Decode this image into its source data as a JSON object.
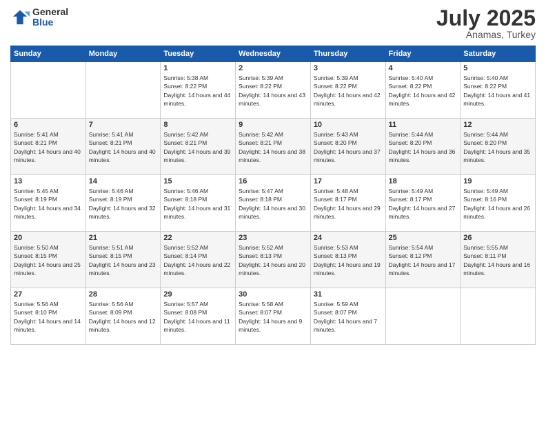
{
  "logo": {
    "general": "General",
    "blue": "Blue"
  },
  "header": {
    "month": "July 2025",
    "location": "Anamas, Turkey"
  },
  "weekdays": [
    "Sunday",
    "Monday",
    "Tuesday",
    "Wednesday",
    "Thursday",
    "Friday",
    "Saturday"
  ],
  "weeks": [
    [
      {
        "day": "",
        "info": ""
      },
      {
        "day": "",
        "info": ""
      },
      {
        "day": "1",
        "info": "Sunrise: 5:38 AM\nSunset: 8:22 PM\nDaylight: 14 hours and 44 minutes."
      },
      {
        "day": "2",
        "info": "Sunrise: 5:39 AM\nSunset: 8:22 PM\nDaylight: 14 hours and 43 minutes."
      },
      {
        "day": "3",
        "info": "Sunrise: 5:39 AM\nSunset: 8:22 PM\nDaylight: 14 hours and 42 minutes."
      },
      {
        "day": "4",
        "info": "Sunrise: 5:40 AM\nSunset: 8:22 PM\nDaylight: 14 hours and 42 minutes."
      },
      {
        "day": "5",
        "info": "Sunrise: 5:40 AM\nSunset: 8:22 PM\nDaylight: 14 hours and 41 minutes."
      }
    ],
    [
      {
        "day": "6",
        "info": "Sunrise: 5:41 AM\nSunset: 8:21 PM\nDaylight: 14 hours and 40 minutes."
      },
      {
        "day": "7",
        "info": "Sunrise: 5:41 AM\nSunset: 8:21 PM\nDaylight: 14 hours and 40 minutes."
      },
      {
        "day": "8",
        "info": "Sunrise: 5:42 AM\nSunset: 8:21 PM\nDaylight: 14 hours and 39 minutes."
      },
      {
        "day": "9",
        "info": "Sunrise: 5:42 AM\nSunset: 8:21 PM\nDaylight: 14 hours and 38 minutes."
      },
      {
        "day": "10",
        "info": "Sunrise: 5:43 AM\nSunset: 8:20 PM\nDaylight: 14 hours and 37 minutes."
      },
      {
        "day": "11",
        "info": "Sunrise: 5:44 AM\nSunset: 8:20 PM\nDaylight: 14 hours and 36 minutes."
      },
      {
        "day": "12",
        "info": "Sunrise: 5:44 AM\nSunset: 8:20 PM\nDaylight: 14 hours and 35 minutes."
      }
    ],
    [
      {
        "day": "13",
        "info": "Sunrise: 5:45 AM\nSunset: 8:19 PM\nDaylight: 14 hours and 34 minutes."
      },
      {
        "day": "14",
        "info": "Sunrise: 5:46 AM\nSunset: 8:19 PM\nDaylight: 14 hours and 32 minutes."
      },
      {
        "day": "15",
        "info": "Sunrise: 5:46 AM\nSunset: 8:18 PM\nDaylight: 14 hours and 31 minutes."
      },
      {
        "day": "16",
        "info": "Sunrise: 5:47 AM\nSunset: 8:18 PM\nDaylight: 14 hours and 30 minutes."
      },
      {
        "day": "17",
        "info": "Sunrise: 5:48 AM\nSunset: 8:17 PM\nDaylight: 14 hours and 29 minutes."
      },
      {
        "day": "18",
        "info": "Sunrise: 5:49 AM\nSunset: 8:17 PM\nDaylight: 14 hours and 27 minutes."
      },
      {
        "day": "19",
        "info": "Sunrise: 5:49 AM\nSunset: 8:16 PM\nDaylight: 14 hours and 26 minutes."
      }
    ],
    [
      {
        "day": "20",
        "info": "Sunrise: 5:50 AM\nSunset: 8:15 PM\nDaylight: 14 hours and 25 minutes."
      },
      {
        "day": "21",
        "info": "Sunrise: 5:51 AM\nSunset: 8:15 PM\nDaylight: 14 hours and 23 minutes."
      },
      {
        "day": "22",
        "info": "Sunrise: 5:52 AM\nSunset: 8:14 PM\nDaylight: 14 hours and 22 minutes."
      },
      {
        "day": "23",
        "info": "Sunrise: 5:52 AM\nSunset: 8:13 PM\nDaylight: 14 hours and 20 minutes."
      },
      {
        "day": "24",
        "info": "Sunrise: 5:53 AM\nSunset: 8:13 PM\nDaylight: 14 hours and 19 minutes."
      },
      {
        "day": "25",
        "info": "Sunrise: 5:54 AM\nSunset: 8:12 PM\nDaylight: 14 hours and 17 minutes."
      },
      {
        "day": "26",
        "info": "Sunrise: 5:55 AM\nSunset: 8:11 PM\nDaylight: 14 hours and 16 minutes."
      }
    ],
    [
      {
        "day": "27",
        "info": "Sunrise: 5:56 AM\nSunset: 8:10 PM\nDaylight: 14 hours and 14 minutes."
      },
      {
        "day": "28",
        "info": "Sunrise: 5:56 AM\nSunset: 8:09 PM\nDaylight: 14 hours and 12 minutes."
      },
      {
        "day": "29",
        "info": "Sunrise: 5:57 AM\nSunset: 8:08 PM\nDaylight: 14 hours and 11 minutes."
      },
      {
        "day": "30",
        "info": "Sunrise: 5:58 AM\nSunset: 8:07 PM\nDaylight: 14 hours and 9 minutes."
      },
      {
        "day": "31",
        "info": "Sunrise: 5:59 AM\nSunset: 8:07 PM\nDaylight: 14 hours and 7 minutes."
      },
      {
        "day": "",
        "info": ""
      },
      {
        "day": "",
        "info": ""
      }
    ]
  ]
}
